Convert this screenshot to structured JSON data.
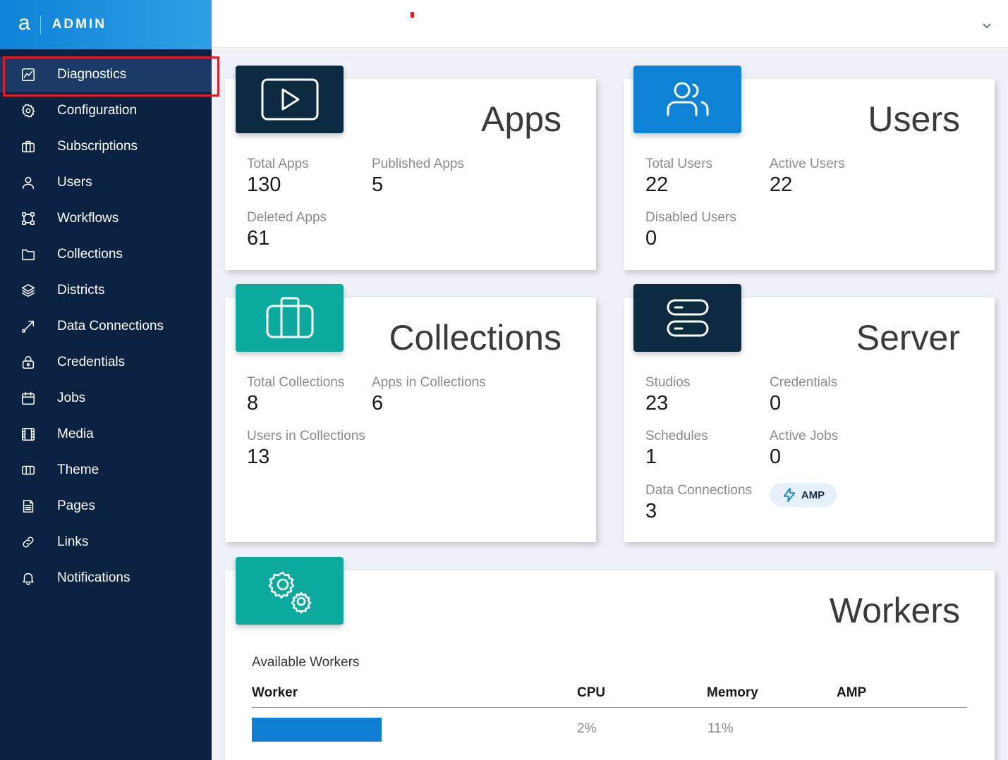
{
  "brand": {
    "logo": "a",
    "title": "ADMIN"
  },
  "sidebar": {
    "items": [
      {
        "label": "Diagnostics",
        "icon": "chart-icon",
        "active": true
      },
      {
        "label": "Configuration",
        "icon": "gear-icon"
      },
      {
        "label": "Subscriptions",
        "icon": "briefcase-icon"
      },
      {
        "label": "Users",
        "icon": "user-icon"
      },
      {
        "label": "Workflows",
        "icon": "workflow-icon"
      },
      {
        "label": "Collections",
        "icon": "folder-icon"
      },
      {
        "label": "Districts",
        "icon": "layers-icon"
      },
      {
        "label": "Data Connections",
        "icon": "connection-icon"
      },
      {
        "label": "Credentials",
        "icon": "lock-icon"
      },
      {
        "label": "Jobs",
        "icon": "calendar-icon"
      },
      {
        "label": "Media",
        "icon": "film-icon"
      },
      {
        "label": "Theme",
        "icon": "theme-icon"
      },
      {
        "label": "Pages",
        "icon": "document-icon"
      },
      {
        "label": "Links",
        "icon": "link-icon"
      },
      {
        "label": "Notifications",
        "icon": "bell-icon"
      }
    ]
  },
  "cards": {
    "apps": {
      "title": "Apps",
      "icon": "play-icon",
      "stats": [
        {
          "label": "Total Apps",
          "value": "130"
        },
        {
          "label": "Published Apps",
          "value": "5"
        },
        {
          "label": "Deleted Apps",
          "value": "61"
        }
      ]
    },
    "users": {
      "title": "Users",
      "icon": "users-icon",
      "stats": [
        {
          "label": "Total Users",
          "value": "22"
        },
        {
          "label": "Active Users",
          "value": "22"
        },
        {
          "label": "Disabled Users",
          "value": "0"
        }
      ]
    },
    "collections": {
      "title": "Collections",
      "icon": "briefcase-icon",
      "stats": [
        {
          "label": "Total Collections",
          "value": "8"
        },
        {
          "label": "Apps in Collections",
          "value": "6"
        },
        {
          "label": "Users in Collections",
          "value": "13"
        }
      ]
    },
    "server": {
      "title": "Server",
      "icon": "server-icon",
      "stats": [
        {
          "label": "Studios",
          "value": "23"
        },
        {
          "label": "Credentials",
          "value": "0"
        },
        {
          "label": "Schedules",
          "value": "1"
        },
        {
          "label": "Active Jobs",
          "value": "0"
        },
        {
          "label": "Data Connections",
          "value": "3"
        }
      ],
      "badge": "AMP"
    },
    "workers": {
      "title": "Workers",
      "icon": "gears-icon",
      "subtitle": "Available Workers",
      "columns": [
        "Worker",
        "CPU",
        "Memory",
        "AMP"
      ],
      "rows": [
        {
          "worker": "",
          "cpu": "2%",
          "memory": "11%",
          "amp": ""
        }
      ]
    }
  },
  "colors": {
    "sidebar": "#0b2243",
    "accent": "#0e83d6",
    "teal": "#0ca99e",
    "highlight": "#e21d2a"
  }
}
